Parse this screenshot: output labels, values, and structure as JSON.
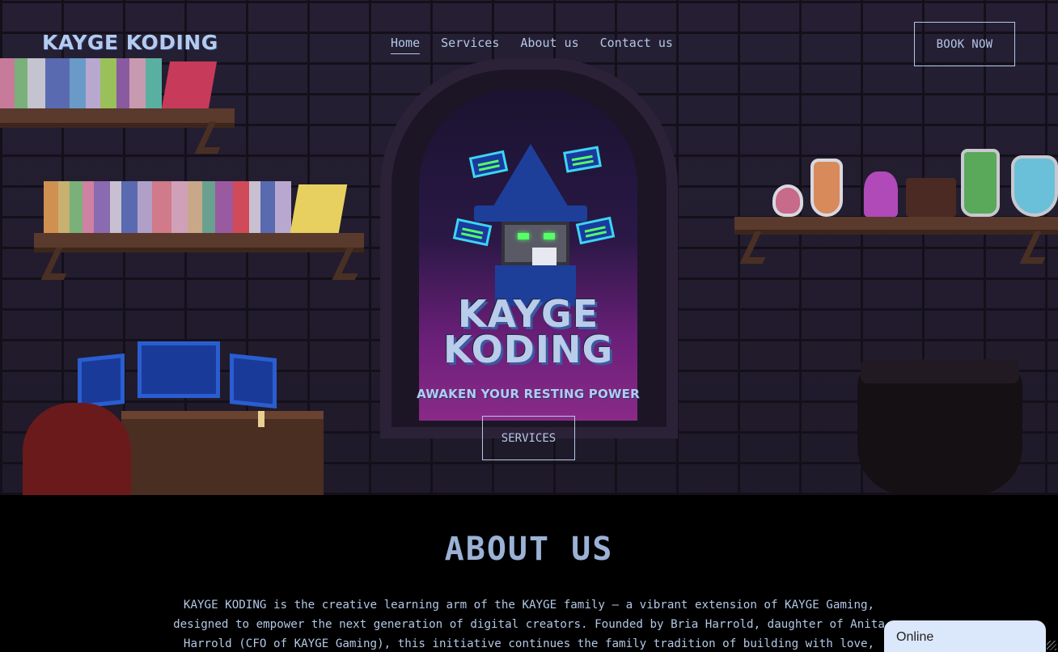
{
  "header": {
    "brand": "KAYGE KODING",
    "nav": [
      {
        "label": "Home",
        "active": true
      },
      {
        "label": "Services",
        "active": false
      },
      {
        "label": "About us",
        "active": false
      },
      {
        "label": "Contact us",
        "active": false
      }
    ],
    "cta_label": "BOOK NOW"
  },
  "hero": {
    "logo_line1": "KAYGE",
    "logo_line2": "KODING",
    "tagline": "AWAKEN YOUR RESTING POWER",
    "button_label": "SERVICES"
  },
  "about": {
    "title": "ABOUT US",
    "text": "KAYGE KODING is the creative learning arm of the KAYGE family — a vibrant extension of KAYGE Gaming, designed to empower the next generation of digital creators. Founded by Bria Harrold, daughter of Anita Harrold (CFO of KAYGE Gaming), this initiative continues the family tradition of building with love, purpose, and community at its core."
  },
  "chat_widget": {
    "status": "Online"
  },
  "colors": {
    "accent": "#b3c8e6",
    "background": "#000000",
    "hero_wall": "#2f273f"
  }
}
